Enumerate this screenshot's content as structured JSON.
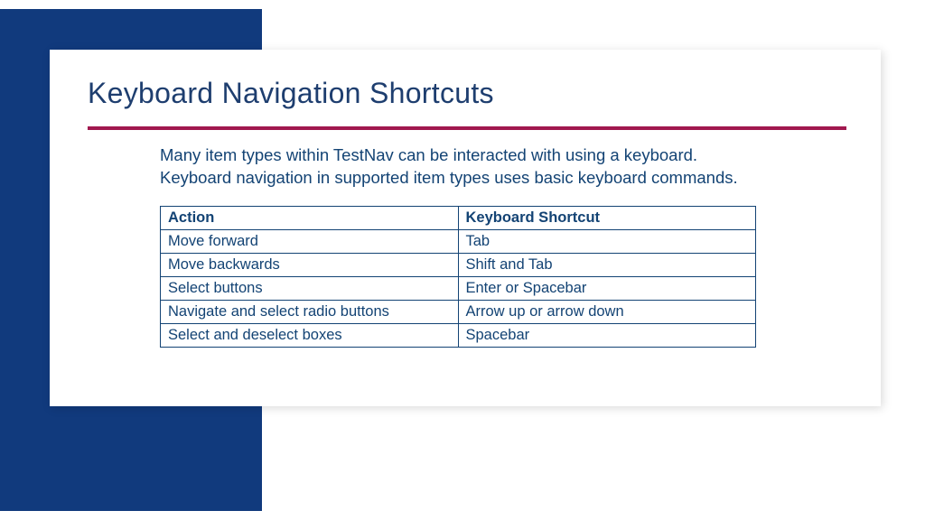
{
  "title": "Keyboard Navigation Shortcuts",
  "body": "Many item types within TestNav can be interacted with using a keyboard. Keyboard navigation in supported item types uses basic keyboard commands.",
  "table": {
    "headers": {
      "action": "Action",
      "shortcut": "Keyboard Shortcut"
    },
    "rows": [
      {
        "action": "Move forward",
        "shortcut": "Tab"
      },
      {
        "action": "Move backwards",
        "shortcut": "Shift and Tab"
      },
      {
        "action": "Select buttons",
        "shortcut": "Enter or Spacebar"
      },
      {
        "action": "Navigate and select radio buttons",
        "shortcut": "Arrow up or arrow down"
      },
      {
        "action": "Select and deselect boxes",
        "shortcut": "Spacebar"
      }
    ]
  }
}
